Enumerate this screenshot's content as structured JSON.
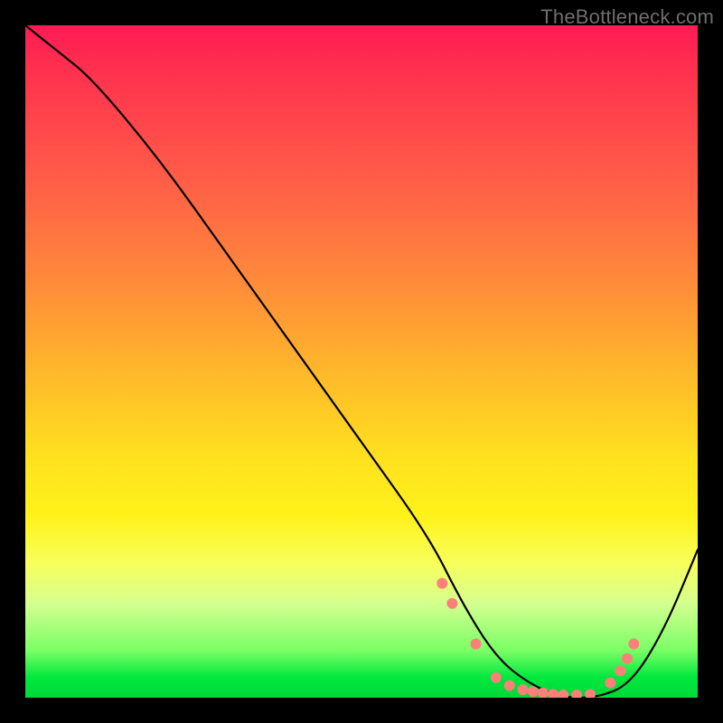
{
  "watermark": "TheBottleneck.com",
  "chart_data": {
    "type": "line",
    "title": "",
    "xlabel": "",
    "ylabel": "",
    "xlim": [
      0,
      100
    ],
    "ylim": [
      0,
      100
    ],
    "grid": false,
    "legend": false,
    "series": [
      {
        "name": "bottleneck-curve",
        "x": [
          0,
          5,
          10,
          20,
          30,
          40,
          50,
          60,
          65,
          70,
          75,
          80,
          85,
          90,
          95,
          100
        ],
        "y": [
          100,
          96,
          92,
          80,
          66,
          52,
          38,
          24,
          14,
          6,
          2,
          0,
          0,
          2,
          10,
          22
        ]
      }
    ],
    "markers": {
      "name": "highlight-dots",
      "color": "#fd7f7a",
      "x": [
        62,
        63.5,
        67,
        70,
        72,
        74,
        75.5,
        77,
        78.5,
        80,
        82,
        84,
        87,
        88.5,
        89.5,
        90.5
      ],
      "y": [
        17,
        14,
        8,
        3,
        1.8,
        1.2,
        0.9,
        0.7,
        0.5,
        0.4,
        0.4,
        0.5,
        2.2,
        4.0,
        5.8,
        8.0
      ]
    },
    "background_gradient": {
      "stops": [
        {
          "pos": 0,
          "color": "#ff1a55"
        },
        {
          "pos": 22,
          "color": "#ff5a48"
        },
        {
          "pos": 52,
          "color": "#ffb92a"
        },
        {
          "pos": 73,
          "color": "#fff21a"
        },
        {
          "pos": 93,
          "color": "#7aff66"
        },
        {
          "pos": 100,
          "color": "#00d838"
        }
      ]
    }
  }
}
